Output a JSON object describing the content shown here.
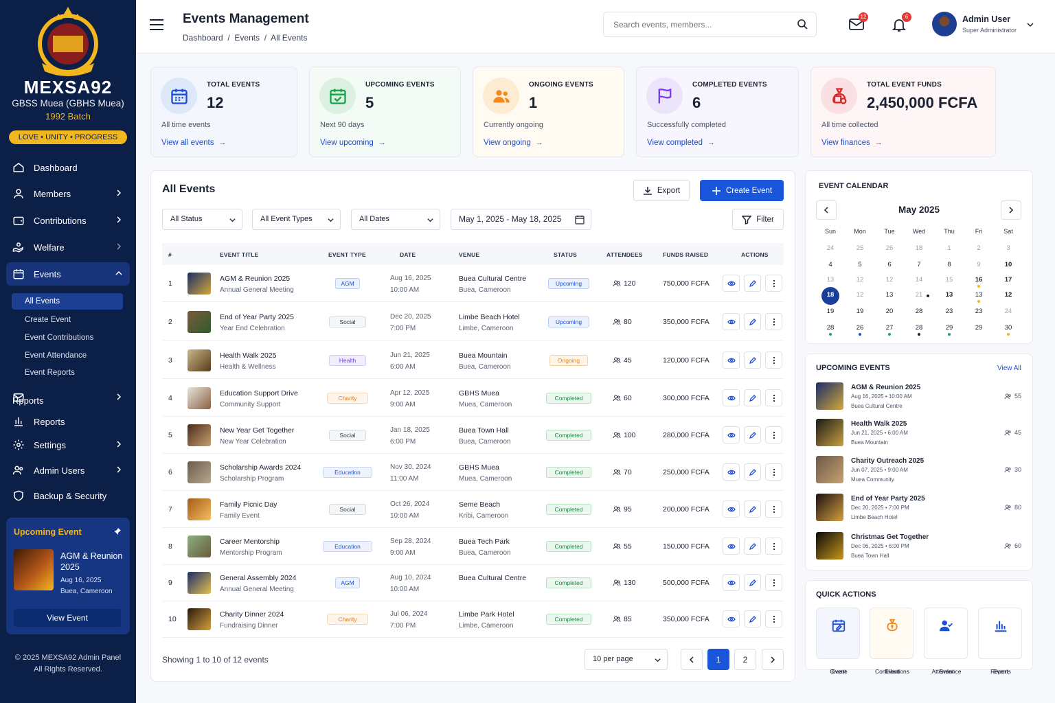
{
  "sidebar": {
    "brand": "MEXSA92",
    "school": "GBSS Muea (GBHS Muea)",
    "batch": "1992 Batch",
    "motto": "LOVE • UNITY • PROGRESS",
    "nav": [
      "Dashboard",
      "Members",
      "Contributions",
      "Welfare",
      "Events",
      "Rpports",
      "Reports",
      "Settings",
      "Admin Users",
      "Backup & Security"
    ],
    "events_sub": [
      "All Events",
      "Create Event",
      "Event Contributions",
      "Event Attendance",
      "Event Reports"
    ],
    "upcoming": {
      "title": "Upcoming Event",
      "name": "AGM & Reunion 2025",
      "date": "Aug 16, 2025",
      "venue": "Buea, Cameroon",
      "button": "View Event"
    },
    "footer1": "© 2025 MEXSA92 Admin Panel",
    "footer2": "All Rights Reserved."
  },
  "header": {
    "title": "Events Management",
    "crumb1": "Dashboard",
    "crumb2": "Events",
    "crumb3": "All Events",
    "search_placeholder": "Search events, members...",
    "mail_count": "12",
    "notif_count": "6",
    "user_name": "Admin User",
    "user_role": "Super Administrator"
  },
  "stats": [
    {
      "label": "TOTAL EVENTS",
      "value": "12",
      "sub": "All time events",
      "link": "View all events"
    },
    {
      "label": "UPCOMING EVENTS",
      "value": "5",
      "sub": "Next 90 days",
      "link": "View upcoming"
    },
    {
      "label": "ONGOING EVENTS",
      "value": "1",
      "sub": "Currently ongoing",
      "link": "View ongoing"
    },
    {
      "label": "COMPLETED EVENTS",
      "value": "6",
      "sub": "Successfully completed",
      "link": "View completed"
    },
    {
      "label": "TOTAL EVENT FUNDS",
      "value": "2,450,000 FCFA",
      "sub": "All time collected",
      "link": "View finances"
    }
  ],
  "events": {
    "title": "All Events",
    "export": "Export",
    "create": "Create Event",
    "filter_status": "All Status",
    "filter_types": "All Event Types",
    "filter_dates": "All Dates",
    "date_range": "May 1, 2025 - May 18, 2025",
    "filter": "Filter",
    "columns": [
      "#",
      "EVENT TITLE",
      "EVENT TYPE",
      "DATE",
      "VENUE",
      "STATUS",
      "ATTENDEES",
      "FUNDS RAISED",
      "ACTIONS"
    ],
    "rows": [
      {
        "n": "1",
        "title": "AGM & Reunion 2025",
        "sub": "Annual General Meeting",
        "type": "AGM",
        "date": "Aug 16, 2025",
        "time": "10:00 AM",
        "venue": "Buea Cultural Centre",
        "city": "Buea, Cameroon",
        "status": "Upcoming",
        "att": "120",
        "funds": "750,000 FCFA"
      },
      {
        "n": "2",
        "title": "End of Year Party 2025",
        "sub": "Year End Celebration",
        "type": "Social",
        "date": "Dec 20, 2025",
        "time": "7:00 PM",
        "venue": "Limbe Beach Hotel",
        "city": "Limbe, Cameroon",
        "status": "Upcoming",
        "att": "80",
        "funds": "350,000 FCFA"
      },
      {
        "n": "3",
        "title": "Health Walk 2025",
        "sub": "Health & Wellness",
        "type": "Health",
        "date": "Jun 21, 2025",
        "time": "6:00 AM",
        "venue": "Buea Mountain",
        "city": "Buea, Cameroon",
        "status": "Ongoing",
        "att": "45",
        "funds": "120,000 FCFA"
      },
      {
        "n": "4",
        "title": "Education Support Drive",
        "sub": "Community Support",
        "type": "Charity",
        "date": "Apr 12, 2025",
        "time": "9:00 AM",
        "venue": "GBHS Muea",
        "city": "Muea, Cameroon",
        "status": "Completed",
        "att": "60",
        "funds": "300,000 FCFA"
      },
      {
        "n": "5",
        "title": "New Year Get Together",
        "sub": "New Year Celebration",
        "type": "Social",
        "date": "Jan 18, 2025",
        "time": "6:00 PM",
        "venue": "Buea Town Hall",
        "city": "Buea, Cameroon",
        "status": "Completed",
        "att": "100",
        "funds": "280,000 FCFA"
      },
      {
        "n": "6",
        "title": "Scholarship Awards 2024",
        "sub": "Scholarship Program",
        "type": "Education",
        "date": "Nov 30, 2024",
        "time": "11:00 AM",
        "venue": "GBHS Muea",
        "city": "Muea, Cameroon",
        "status": "Completed",
        "att": "70",
        "funds": "250,000 FCFA"
      },
      {
        "n": "7",
        "title": "Family Picnic Day",
        "sub": "Family Event",
        "type": "Social",
        "date": "Oct 26, 2024",
        "time": "10:00 AM",
        "venue": "Seme Beach",
        "city": "Kribi, Cameroon",
        "status": "Completed",
        "att": "95",
        "funds": "200,000 FCFA"
      },
      {
        "n": "8",
        "title": "Career Mentorship",
        "sub": "Mentorship Program",
        "type": "Education",
        "date": "Sep 28, 2024",
        "time": "9:00 AM",
        "venue": "Buea Tech Park",
        "city": "Buea, Cameroon",
        "status": "Completed",
        "att": "55",
        "funds": "150,000 FCFA"
      },
      {
        "n": "9",
        "title": "General Assembly 2024",
        "sub": "Annual General Meeting",
        "type": "AGM",
        "date": "Aug 10, 2024",
        "time": "10:00 AM",
        "venue": "Buea Cultural Centre",
        "city": "",
        "status": "Completed",
        "att": "130",
        "funds": "500,000 FCFA"
      },
      {
        "n": "10",
        "title": "Charity Dinner 2024",
        "sub": "Fundraising Dinner",
        "type": "Charity",
        "date": "Jul 06, 2024",
        "time": "7:00 PM",
        "venue": "Limbe Park Hotel",
        "city": "Limbe, Cameroon",
        "status": "Completed",
        "att": "85",
        "funds": "350,000 FCFA"
      }
    ],
    "showing": "Showing 1 to 10 of 12 events",
    "per_page": "10 per page",
    "pages": [
      "1",
      "2"
    ]
  },
  "calendar": {
    "title": "EVENT CALENDAR",
    "month": "May 2025",
    "dow": [
      "Sun",
      "Mon",
      "Tue",
      "Wed",
      "Thu",
      "Fri",
      "Sat"
    ],
    "days": [
      [
        "24",
        "25",
        "26",
        "18",
        "1",
        "2",
        "3"
      ],
      [
        "4",
        "5",
        "6",
        "7",
        "8",
        "9",
        "10"
      ],
      [
        "13",
        "12",
        "12",
        "14",
        "15",
        "16",
        "17"
      ],
      [
        "18",
        "12",
        "13",
        "21",
        "13",
        "13",
        "12"
      ],
      [
        "19",
        "19",
        "20",
        "28",
        "23",
        "23",
        "24"
      ],
      [
        "28",
        "26",
        "27",
        "28",
        "29",
        "29",
        "30"
      ]
    ]
  },
  "upcoming_events": {
    "title": "UPCOMING EVENTS",
    "view_all": "View All",
    "items": [
      {
        "name": "AGM & Reunion 2025",
        "date": "Aug 16, 2025 • 10:00 AM",
        "venue": "Buea Cultural Centre",
        "att": "55"
      },
      {
        "name": "Health Walk 2025",
        "date": "Jun 21, 2025 • 6:00 AM",
        "venue": "Buea Mountain",
        "att": "45"
      },
      {
        "name": "Charity Outreach 2025",
        "date": "Jun 07, 2025 • 9:00 AM",
        "venue": "Muea Community",
        "att": "30"
      },
      {
        "name": "End of Year Party 2025",
        "date": "Dec 20, 2025 • 7:00 PM",
        "venue": "Limbe Beach Hotel",
        "att": "80"
      },
      {
        "name": "Christmas Get Together",
        "date": "Dec 06, 2025 • 6:00 PM",
        "venue": "Buea Town Hall",
        "att": "60"
      }
    ]
  },
  "quick_actions": {
    "title": "QUICK ACTIONS",
    "items": [
      {
        "l1": "Create",
        "l2": "Event"
      },
      {
        "l1": "Event",
        "l2": "Contributions"
      },
      {
        "l1": "Event",
        "l2": "Attendance"
      },
      {
        "l1": "Event",
        "l2": "Reports"
      }
    ]
  },
  "colors": {
    "navy": "#0c1f47",
    "accent": "#1d4ed8",
    "gold": "#f2b61f"
  }
}
